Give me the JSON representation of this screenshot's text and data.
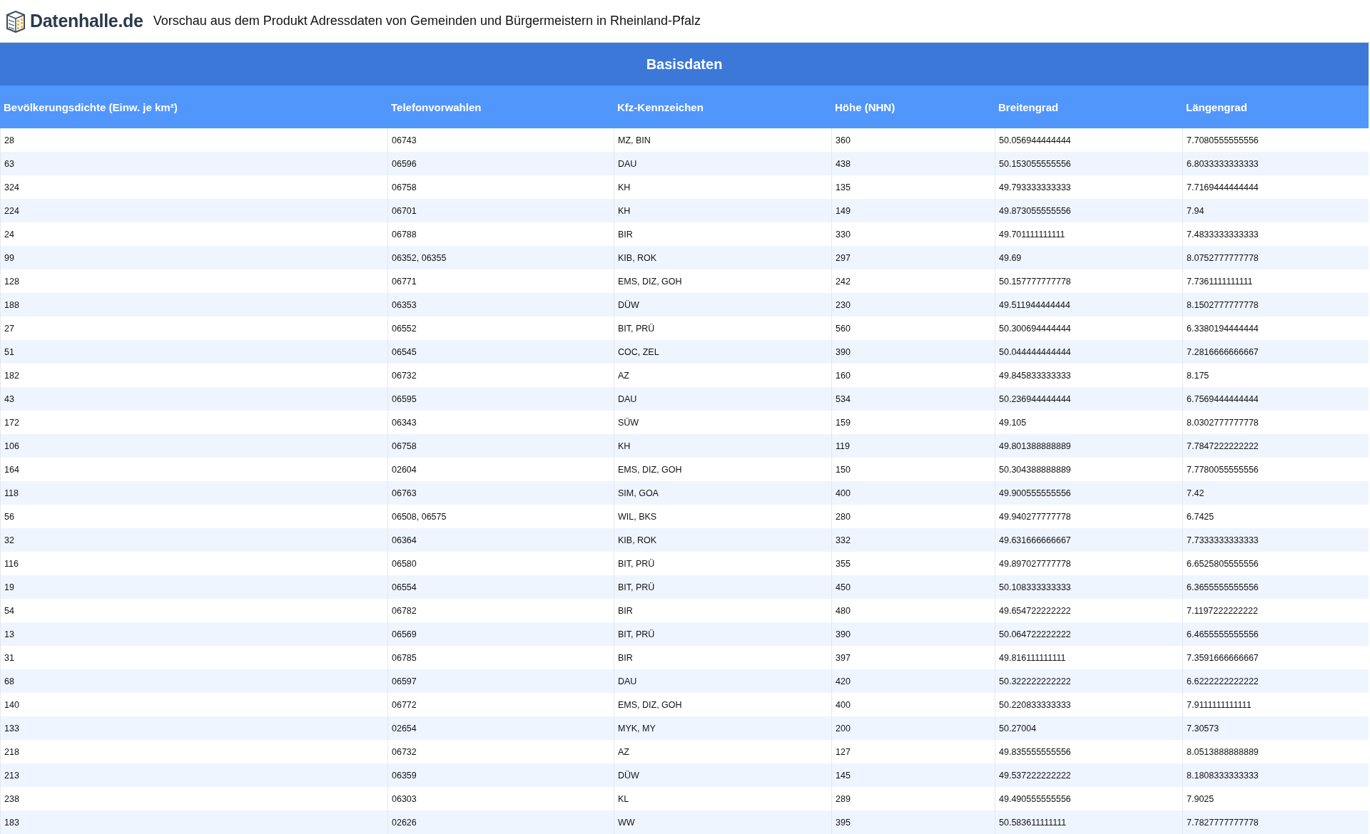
{
  "header": {
    "logo": "Datenhalle.de",
    "title": "Vorschau aus dem Produkt Adressdaten von Gemeinden und Bürgermeistern in Rheinland-Pfalz"
  },
  "table": {
    "group_title": "Basisdaten",
    "columns": [
      "Bevölkerungsdichte (Einw. je km²)",
      "Telefonvorwahlen",
      "Kfz-Kennzeichen",
      "Höhe (NHN)",
      "Breitengrad",
      "Längengrad"
    ],
    "rows": [
      [
        "28",
        "06743",
        "MZ, BIN",
        "360",
        "50.056944444444",
        "7.7080555555556"
      ],
      [
        "63",
        "06596",
        "DAU",
        "438",
        "50.153055555556",
        "6.8033333333333"
      ],
      [
        "324",
        "06758",
        "KH",
        "135",
        "49.793333333333",
        "7.7169444444444"
      ],
      [
        "224",
        "06701",
        "KH",
        "149",
        "49.873055555556",
        "7.94"
      ],
      [
        "24",
        "06788",
        "BIR",
        "330",
        "49.701111111111",
        "7.4833333333333"
      ],
      [
        "99",
        "06352, 06355",
        "KIB, ROK",
        "297",
        "49.69",
        "8.0752777777778"
      ],
      [
        "128",
        "06771",
        "EMS, DIZ, GOH",
        "242",
        "50.157777777778",
        "7.7361111111111"
      ],
      [
        "188",
        "06353",
        "DÜW",
        "230",
        "49.511944444444",
        "8.1502777777778"
      ],
      [
        "27",
        "06552",
        "BIT, PRÜ",
        "560",
        "50.300694444444",
        "6.3380194444444"
      ],
      [
        "51",
        "06545",
        "COC, ZEL",
        "390",
        "50.044444444444",
        "7.2816666666667"
      ],
      [
        "182",
        "06732",
        "AZ",
        "160",
        "49.845833333333",
        "8.175"
      ],
      [
        "43",
        "06595",
        "DAU",
        "534",
        "50.236944444444",
        "6.7569444444444"
      ],
      [
        "172",
        "06343",
        "SÜW",
        "159",
        "49.105",
        "8.0302777777778"
      ],
      [
        "106",
        "06758",
        "KH",
        "119",
        "49.801388888889",
        "7.7847222222222"
      ],
      [
        "164",
        "02604",
        "EMS, DIZ, GOH",
        "150",
        "50.304388888889",
        "7.7780055555556"
      ],
      [
        "118",
        "06763",
        "SIM, GOA",
        "400",
        "49.900555555556",
        "7.42"
      ],
      [
        "56",
        "06508, 06575",
        "WIL, BKS",
        "280",
        "49.940277777778",
        "6.7425"
      ],
      [
        "32",
        "06364",
        "KIB, ROK",
        "332",
        "49.631666666667",
        "7.7333333333333"
      ],
      [
        "116",
        "06580",
        "BIT, PRÜ",
        "355",
        "49.897027777778",
        "6.6525805555556"
      ],
      [
        "19",
        "06554",
        "BIT, PRÜ",
        "450",
        "50.108333333333",
        "6.3655555555556"
      ],
      [
        "54",
        "06782",
        "BIR",
        "480",
        "49.654722222222",
        "7.1197222222222"
      ],
      [
        "13",
        "06569",
        "BIT, PRÜ",
        "390",
        "50.064722222222",
        "6.4655555555556"
      ],
      [
        "31",
        "06785",
        "BIR",
        "397",
        "49.816111111111",
        "7.3591666666667"
      ],
      [
        "68",
        "06597",
        "DAU",
        "420",
        "50.322222222222",
        "6.6222222222222"
      ],
      [
        "140",
        "06772",
        "EMS, DIZ, GOH",
        "400",
        "50.220833333333",
        "7.9111111111111"
      ],
      [
        "133",
        "02654",
        "MYK, MY",
        "200",
        "50.27004",
        "7.30573"
      ],
      [
        "218",
        "06732",
        "AZ",
        "127",
        "49.835555555556",
        "8.0513888888889"
      ],
      [
        "213",
        "06359",
        "DÜW",
        "145",
        "49.537222222222",
        "8.1808333333333"
      ],
      [
        "238",
        "06303",
        "KL",
        "289",
        "49.490555555556",
        "7.9025"
      ],
      [
        "183",
        "02626",
        "WW",
        "395",
        "50.583611111111",
        "7.7827777777778"
      ]
    ]
  }
}
